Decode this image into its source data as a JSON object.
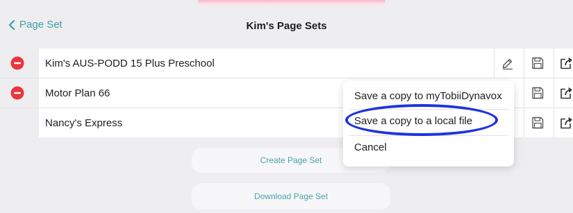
{
  "nav": {
    "back_label": "Page Set",
    "title": "Kim's Page Sets"
  },
  "page_sets": [
    {
      "name": "Kim's AUS-PODD 15 Plus Preschool",
      "deletable": true
    },
    {
      "name": "Motor Plan 66",
      "deletable": true
    },
    {
      "name": "Nancy's Express",
      "deletable": false
    }
  ],
  "popup": {
    "items": [
      "Save a copy to myTobiiDynavox",
      "Save a copy to a local file",
      "Cancel"
    ],
    "highlighted_item": "Save a copy to a local file"
  },
  "buttons": {
    "create": "Create Page Set",
    "download": "Download Page Set"
  },
  "icons": [
    "chevron-left-icon",
    "minus-circle-icon",
    "pencil-icon",
    "save-floppy-icon",
    "share-export-icon"
  ],
  "colors": {
    "accent": "#3ea0a6",
    "delete": "#e8363f",
    "highlight_ring": "#1f33e0",
    "background": "#eeeef1",
    "decor_bar": "#f7b9c8"
  }
}
